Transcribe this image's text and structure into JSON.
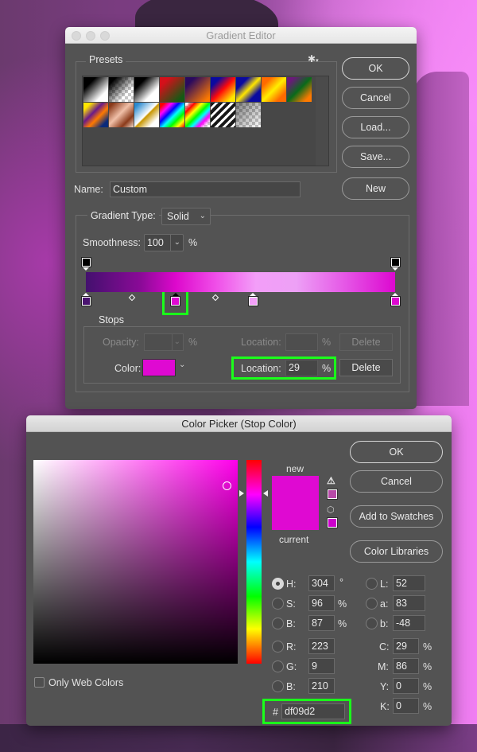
{
  "gradient_editor": {
    "title": "Gradient Editor",
    "presets_label": "Presets",
    "settings_icon": "gear-icon",
    "buttons": {
      "ok": "OK",
      "cancel": "Cancel",
      "load": "Load...",
      "save": "Save...",
      "new": "New"
    },
    "name_label": "Name:",
    "name_value": "Custom",
    "gradient_type_label": "Gradient Type:",
    "gradient_type_value": "Solid",
    "smoothness_label": "Smoothness:",
    "smoothness_value": "100",
    "smoothness_unit": "%",
    "preset_swatches": [
      "black-white",
      "black-transparent",
      "black-white-2",
      "red-green",
      "violet-orange",
      "blue-red-yellow",
      "blue-yellow-blue",
      "orange-yellow-orange",
      "violet-green-orange",
      "yellow-violet-orange-blue",
      "copper",
      "chrome",
      "spectrum",
      "transparent-rainbow",
      "transparent-stripes",
      "neutral-density"
    ],
    "gradient_stops": {
      "opacity_stops": [
        {
          "location": 0,
          "color": "#000000"
        },
        {
          "location": 100,
          "color": "#000000"
        }
      ],
      "color_stops": [
        {
          "location": 0,
          "color": "#4a1470"
        },
        {
          "location": 29,
          "color": "#df09d2",
          "selected": true
        },
        {
          "location": 54,
          "color": "#f3a0f8"
        },
        {
          "location": 100,
          "color": "#dc08d0"
        }
      ],
      "midpoints": [
        15,
        42
      ]
    },
    "stops": {
      "label": "Stops",
      "opacity_label": "Opacity:",
      "opacity_value": "",
      "opacity_unit": "%",
      "opacity_location_label": "Location:",
      "opacity_location_value": "",
      "opacity_location_unit": "%",
      "opacity_delete": "Delete",
      "color_label": "Color:",
      "color_value": "#df09d2",
      "color_location_label": "Location:",
      "color_location_value": "29",
      "color_location_unit": "%",
      "color_delete": "Delete"
    }
  },
  "color_picker": {
    "title": "Color Picker (Stop Color)",
    "buttons": {
      "ok": "OK",
      "cancel": "Cancel",
      "add_to_swatches": "Add to Swatches",
      "color_libraries": "Color Libraries"
    },
    "new_label": "new",
    "current_label": "current",
    "new_color": "#df09d2",
    "current_color": "#df09d2",
    "gamut_warning_color": "#b74aa8",
    "web_safe_color": "#cc00cc",
    "hsb": {
      "h_label": "H:",
      "h_value": "304",
      "h_unit": "°",
      "s_label": "S:",
      "s_value": "96",
      "s_unit": "%",
      "b_label": "B:",
      "b_value": "87",
      "b_unit": "%"
    },
    "rgb": {
      "r_label": "R:",
      "r_value": "223",
      "g_label": "G:",
      "g_value": "9",
      "b_label": "B:",
      "b_value": "210"
    },
    "lab": {
      "l_label": "L:",
      "l_value": "52",
      "a_label": "a:",
      "a_value": "83",
      "b_label": "b:",
      "b_value": "-48"
    },
    "cmyk": {
      "c_label": "C:",
      "c_value": "29",
      "c_unit": "%",
      "m_label": "M:",
      "m_value": "86",
      "m_unit": "%",
      "y_label": "Y:",
      "y_value": "0",
      "y_unit": "%",
      "k_label": "K:",
      "k_value": "0",
      "k_unit": "%"
    },
    "hex_label": "#",
    "hex_value": "df09d2",
    "only_web_colors_label": "Only Web Colors",
    "only_web_colors_checked": false,
    "selected_model": "H",
    "hue_field_color": "#ff00ea"
  },
  "highlight_color": "#1aff1a"
}
